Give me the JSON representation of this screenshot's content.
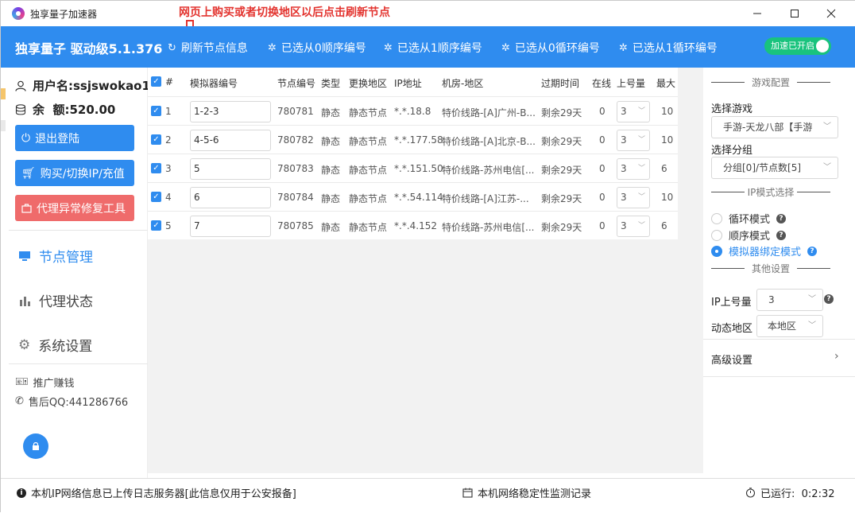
{
  "window": {
    "title": "独享量子加速器",
    "annotation": "网页上购买或者切换地区以后点击刷新节点"
  },
  "header": {
    "brand": "独享量子 驱动级5.1.376",
    "buttons": [
      {
        "label": "刷新节点信息",
        "icon": "refresh-icon"
      },
      {
        "label": "已选从0顺序编号",
        "icon": "sparkle-icon"
      },
      {
        "label": "已选从1顺序编号",
        "icon": "sparkle-icon"
      },
      {
        "label": "已选从0循环编号",
        "icon": "sparkle-icon"
      },
      {
        "label": "已选从1循环编号",
        "icon": "sparkle-icon"
      }
    ],
    "toggle_label": "加速已开启",
    "toggle_on": true
  },
  "sidebar": {
    "username": "用户名:ssjswokao1",
    "balance": "余  额:520.00",
    "buttons": {
      "logout": "退出登陆",
      "buy": "购买/切换IP/充值",
      "repair": "代理异常修复工具"
    },
    "nav": {
      "nodes": "节点管理",
      "proxy": "代理状态",
      "settings": "系统设置"
    },
    "promo": "推广赚钱",
    "support": "售后QQ:441286766",
    "colors": {
      "primary": "#2f8cef",
      "danger": "#ef6b6b"
    }
  },
  "table": {
    "headers": [
      "#",
      "模拟器编号",
      "节点编号",
      "类型",
      "更换地区",
      "IP地址",
      "机房-地区",
      "过期时间",
      "在线",
      "上号量",
      "最大"
    ],
    "rows": [
      {
        "num": "1",
        "emu": "1-2-3",
        "node": "780781",
        "type": "静态",
        "change": "静态节点",
        "ip": "*.*.18.8",
        "room": "特价线路-[A]广州-B...",
        "expire": "剩余29天",
        "online": "0",
        "count": "3",
        "max": "10"
      },
      {
        "num": "2",
        "emu": "4-5-6",
        "node": "780782",
        "type": "静态",
        "change": "静态节点",
        "ip": "*.*.177.58",
        "room": "特价线路-[A]北京-B...",
        "expire": "剩余29天",
        "online": "0",
        "count": "3",
        "max": "10"
      },
      {
        "num": "3",
        "emu": "5",
        "node": "780783",
        "type": "静态",
        "change": "静态节点",
        "ip": "*.*.151.50",
        "room": "特价线路-苏州电信[...",
        "expire": "剩余29天",
        "online": "0",
        "count": "3",
        "max": "6"
      },
      {
        "num": "4",
        "emu": "6",
        "node": "780784",
        "type": "静态",
        "change": "静态节点",
        "ip": "*.*.54.114",
        "room": "特价线路-[A]江苏-...",
        "expire": "剩余29天",
        "online": "0",
        "count": "3",
        "max": "10"
      },
      {
        "num": "5",
        "emu": "7",
        "node": "780785",
        "type": "静态",
        "change": "静态节点",
        "ip": "*.*.4.152",
        "room": "特价线路-苏州电信[...",
        "expire": "剩余29天",
        "online": "0",
        "count": "3",
        "max": "6"
      }
    ]
  },
  "right_panel": {
    "game_config_title": "游戏配置",
    "select_game_label": "选择游戏",
    "select_game_value": "手游-天龙八部【手游",
    "select_group_label": "选择分组",
    "select_group_value": "分组[0]/节点数[5]",
    "ip_mode_title": "IP模式选择",
    "modes": [
      {
        "label": "循环模式",
        "selected": false
      },
      {
        "label": "顺序模式",
        "selected": false
      },
      {
        "label": "模拟器绑定模式",
        "selected": true
      }
    ],
    "other_title": "其他设置",
    "ip_count_label": "IP上号量",
    "ip_count_value": "3",
    "dynamic_region_label": "动态地区",
    "dynamic_region_value": "本地区",
    "advanced": "高级设置"
  },
  "status_bar": {
    "left": "本机IP网络信息已上传日志服务器[此信息仅用于公安报备]",
    "middle": "本机网络稳定性监测记录",
    "runtime": "已运行:  0:2:32"
  }
}
